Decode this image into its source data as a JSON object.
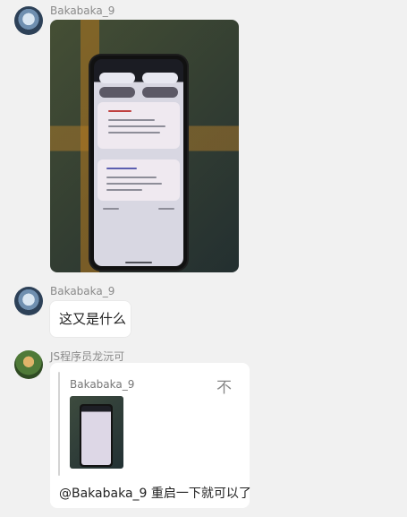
{
  "messages": [
    {
      "sender": "Bakabaka_9"
    },
    {
      "sender": "Bakabaka_9",
      "text": "这又是什么"
    },
    {
      "sender": "JS程序员龙沅可",
      "quoted_name": "Bakabaka_9",
      "close_glyph": "不",
      "reply_text": "@Bakabaka_9 重启一下就可以了"
    }
  ]
}
